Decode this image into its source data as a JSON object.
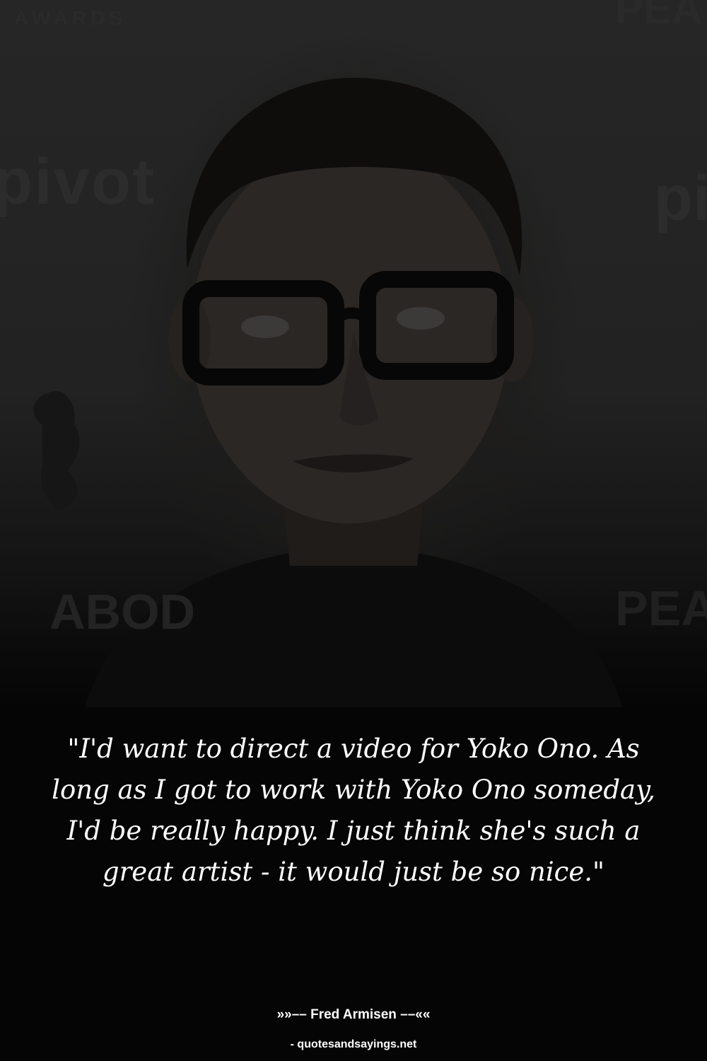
{
  "background_photo": {
    "subject": "portrait-of-man-with-black-glasses",
    "backdrop_text": {
      "pivot_left": "pivot",
      "pivot_right": "pi",
      "peabody_left": "ABOD",
      "peabody_right": "PEA",
      "top_left": "AWARDS",
      "top_right": "PEA"
    }
  },
  "quote": {
    "text": "\"I'd want to direct a video for Yoko Ono. As long as I got to work with Yoko Ono someday, I'd be really happy. I just think she's such a great artist - it would just be so nice.\""
  },
  "attribution": {
    "text": "»»–– Fred Armisen ––««"
  },
  "source": {
    "text": "- quotesandsayings.net"
  }
}
